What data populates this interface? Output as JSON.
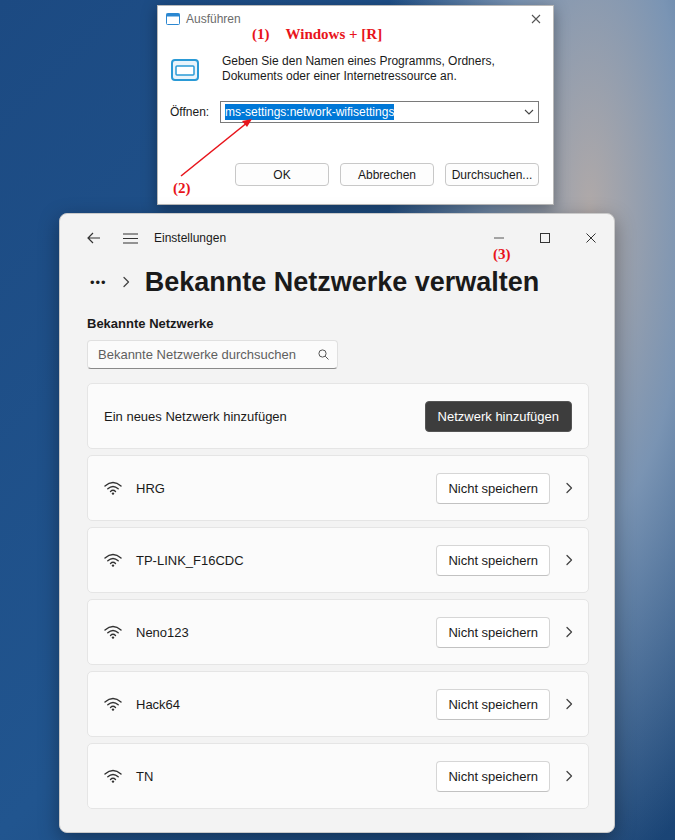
{
  "run_dialog": {
    "title": "Ausführen",
    "annotation_step": "(1)",
    "annotation_shortcut": "Windows + [R]",
    "description": "Geben Sie den Namen eines Programms, Ordners, Dokuments oder einer Internetressource an.",
    "open_label": "Öffnen:",
    "open_value": "ms-settings:network-wifisettings",
    "open_value_selected": true,
    "arrow_label": "(2)",
    "buttons": [
      {
        "label": "OK"
      },
      {
        "label": "Abbrechen"
      },
      {
        "label": "Durchsuchen..."
      }
    ]
  },
  "settings_window": {
    "app_title": "Einstellungen",
    "annotation": "(3)",
    "breadcrumb_more": "•••",
    "page_title": "Bekannte Netzwerke verwalten",
    "section_label": "Bekannte Netzwerke",
    "search": {
      "placeholder": "Bekannte Netzwerke durchsuchen"
    },
    "add_card": {
      "label": "Ein neues Netzwerk hinzufügen",
      "button": "Netzwerk hinzufügen"
    },
    "networks": [
      {
        "name": "HRG",
        "forget_button": "Nicht speichern"
      },
      {
        "name": "TP-LINK_F16CDC",
        "forget_button": "Nicht speichern"
      },
      {
        "name": "Neno123",
        "forget_button": "Nicht speichern"
      },
      {
        "name": "Hack64",
        "forget_button": "Nicht speichern"
      },
      {
        "name": "TN",
        "forget_button": "Nicht speichern"
      }
    ]
  }
}
